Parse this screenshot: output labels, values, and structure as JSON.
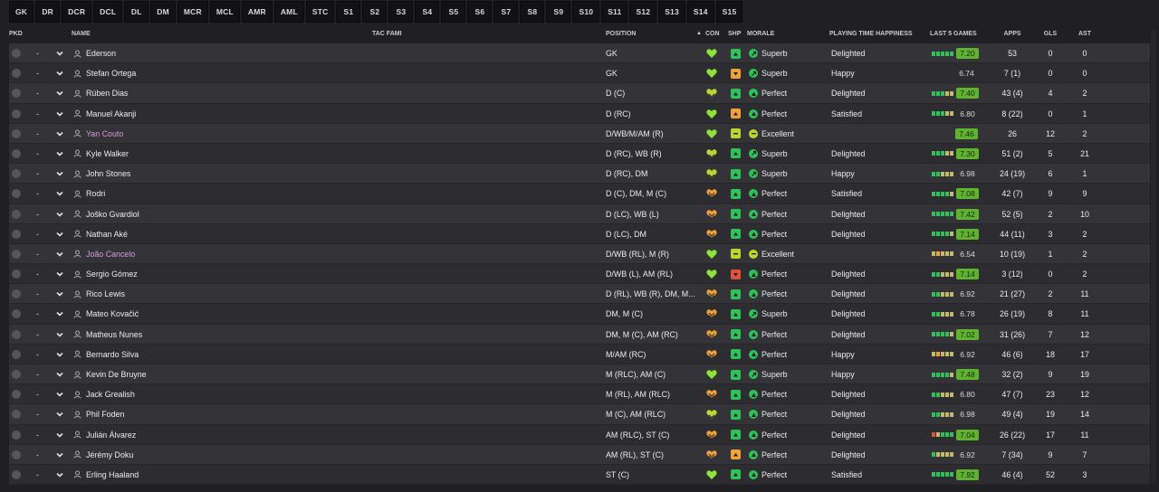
{
  "positions": [
    "GK",
    "DR",
    "DCR",
    "DCL",
    "DL",
    "DM",
    "MCR",
    "MCL",
    "AMR",
    "AML",
    "STC",
    "S1",
    "S2",
    "S3",
    "S4",
    "S5",
    "S6",
    "S7",
    "S8",
    "S9",
    "S10",
    "S11",
    "S12",
    "S13",
    "S14",
    "S15"
  ],
  "columns": {
    "pkd": "PKD",
    "name": "NAME",
    "tac_fami": "TAC FAMI",
    "position": "POSITION",
    "con": "CON",
    "shp": "SHP",
    "morale": "MORALE",
    "happiness": "PLAYING TIME HAPPINESS",
    "last5": "LAST 5 GAMES",
    "apps": "APPS",
    "gls": "GLS",
    "ast": "AST"
  },
  "colors": {
    "green": "#2fc15a",
    "light_green": "#8fe23a",
    "yellow_green": "#b9d631",
    "orange": "#f0a23a",
    "red": "#e0523a",
    "rating_green": "#5fb42e"
  },
  "players": [
    {
      "dash": "-",
      "name": "Ederson",
      "highlight": false,
      "position": "GK",
      "con": "green",
      "shp": "up-green",
      "morale": "Superb",
      "morale_icon": "superb",
      "happiness": "Delighted",
      "form": [
        "g",
        "g",
        "g",
        "g",
        "g"
      ],
      "rating": "7.20",
      "rating_good": true,
      "apps": "53",
      "gls": "0",
      "ast": "0"
    },
    {
      "dash": "-",
      "name": "Stefan Ortega",
      "highlight": false,
      "position": "GK",
      "con": "green",
      "shp": "down-orange",
      "morale": "Superb",
      "morale_icon": "superb",
      "happiness": "Happy",
      "form": [],
      "rating": "6.74",
      "rating_good": false,
      "apps": "7 (1)",
      "gls": "0",
      "ast": "0"
    },
    {
      "dash": "-",
      "name": "Rúben Dias",
      "highlight": false,
      "position": "D (C)",
      "con": "yellow",
      "shp": "up-green",
      "morale": "Perfect",
      "morale_icon": "perfect",
      "happiness": "Delighted",
      "form": [
        "g",
        "g",
        "g",
        "y",
        "y"
      ],
      "rating": "7.40",
      "rating_good": true,
      "apps": "43 (4)",
      "gls": "4",
      "ast": "2"
    },
    {
      "dash": "-",
      "name": "Manuel Akanji",
      "highlight": false,
      "position": "D (RC)",
      "con": "green",
      "shp": "up-orange",
      "morale": "Perfect",
      "morale_icon": "perfect",
      "happiness": "Satisfied",
      "form": [
        "g",
        "g",
        "g",
        "y",
        "y"
      ],
      "rating": "6.80",
      "rating_good": false,
      "apps": "8 (22)",
      "gls": "0",
      "ast": "1"
    },
    {
      "dash": "-",
      "name": "Yan Couto",
      "highlight": true,
      "position": "D/WB/M/AM (R)",
      "con": "green",
      "shp": "neutral-yellow",
      "morale": "Excellent",
      "morale_icon": "excellent",
      "happiness": "",
      "form": [],
      "rating": "7.46",
      "rating_good": true,
      "apps": "26",
      "gls": "12",
      "ast": "2"
    },
    {
      "dash": "-",
      "name": "Kyle Walker",
      "highlight": false,
      "position": "D (RC), WB (R)",
      "con": "yellow",
      "shp": "up-green",
      "morale": "Superb",
      "morale_icon": "superb",
      "happiness": "Delighted",
      "form": [
        "g",
        "g",
        "g",
        "y",
        "y"
      ],
      "rating": "7.30",
      "rating_good": true,
      "apps": "51 (2)",
      "gls": "5",
      "ast": "21"
    },
    {
      "dash": "-",
      "name": "John Stones",
      "highlight": false,
      "position": "D (RC), DM",
      "con": "yellow",
      "shp": "up-green",
      "morale": "Superb",
      "morale_icon": "superb",
      "happiness": "Happy",
      "form": [
        "g",
        "g",
        "y",
        "y",
        "y"
      ],
      "rating": "6.98",
      "rating_good": false,
      "apps": "24 (19)",
      "gls": "6",
      "ast": "1"
    },
    {
      "dash": "-",
      "name": "Rodri",
      "highlight": false,
      "position": "D (C), DM, M (C)",
      "con": "orange",
      "shp": "up-green",
      "morale": "Perfect",
      "morale_icon": "perfect",
      "happiness": "Satisfied",
      "form": [
        "g",
        "g",
        "g",
        "g",
        "y"
      ],
      "rating": "7.08",
      "rating_good": true,
      "apps": "42 (7)",
      "gls": "9",
      "ast": "9"
    },
    {
      "dash": "-",
      "name": "Joško Gvardiol",
      "highlight": false,
      "position": "D (LC), WB (L)",
      "con": "orange",
      "shp": "up-green",
      "morale": "Perfect",
      "morale_icon": "perfect",
      "happiness": "Delighted",
      "form": [
        "g",
        "g",
        "g",
        "g",
        "g"
      ],
      "rating": "7.42",
      "rating_good": true,
      "apps": "52 (5)",
      "gls": "2",
      "ast": "10"
    },
    {
      "dash": "-",
      "name": "Nathan Aké",
      "highlight": false,
      "position": "D (LC), DM",
      "con": "orange",
      "shp": "up-green",
      "morale": "Perfect",
      "morale_icon": "perfect",
      "happiness": "Delighted",
      "form": [
        "g",
        "g",
        "g",
        "g",
        "y"
      ],
      "rating": "7.14",
      "rating_good": true,
      "apps": "44 (11)",
      "gls": "3",
      "ast": "2"
    },
    {
      "dash": "-",
      "name": "João Cancelo",
      "highlight": true,
      "position": "D/WB (RL), M (R)",
      "con": "green",
      "shp": "neutral-yellow",
      "morale": "Excellent",
      "morale_icon": "excellent",
      "happiness": "",
      "form": [
        "y",
        "o",
        "y",
        "y",
        "y"
      ],
      "rating": "6.54",
      "rating_good": false,
      "apps": "10 (19)",
      "gls": "1",
      "ast": "2"
    },
    {
      "dash": "-",
      "name": "Sergio Gómez",
      "highlight": false,
      "position": "D/WB (L), AM (RL)",
      "con": "green",
      "shp": "down-red",
      "morale": "Perfect",
      "morale_icon": "perfect",
      "happiness": "Delighted",
      "form": [
        "g",
        "g",
        "y",
        "y",
        "y"
      ],
      "rating": "7.14",
      "rating_good": true,
      "apps": "3 (12)",
      "gls": "0",
      "ast": "2"
    },
    {
      "dash": "-",
      "name": "Rico Lewis",
      "highlight": false,
      "position": "D (RL), WB (R), DM, M...",
      "con": "orange",
      "shp": "up-green",
      "morale": "Perfect",
      "morale_icon": "perfect",
      "happiness": "Delighted",
      "form": [
        "g",
        "g",
        "y",
        "y",
        "y"
      ],
      "rating": "6.92",
      "rating_good": false,
      "apps": "21 (27)",
      "gls": "2",
      "ast": "11"
    },
    {
      "dash": "-",
      "name": "Mateo Kovačić",
      "highlight": false,
      "position": "DM, M (C)",
      "con": "orange",
      "shp": "up-green",
      "morale": "Superb",
      "morale_icon": "superb",
      "happiness": "Delighted",
      "form": [
        "g",
        "g",
        "y",
        "y",
        "y"
      ],
      "rating": "6.78",
      "rating_good": false,
      "apps": "26 (19)",
      "gls": "8",
      "ast": "11"
    },
    {
      "dash": "-",
      "name": "Matheus Nunes",
      "highlight": false,
      "position": "DM, M (C), AM (RC)",
      "con": "orange",
      "shp": "up-green",
      "morale": "Perfect",
      "morale_icon": "perfect",
      "happiness": "Delighted",
      "form": [
        "g",
        "g",
        "g",
        "g",
        "y"
      ],
      "rating": "7.02",
      "rating_good": true,
      "apps": "31 (26)",
      "gls": "7",
      "ast": "12"
    },
    {
      "dash": "-",
      "name": "Bernardo Silva",
      "highlight": false,
      "position": "M/AM (RC)",
      "con": "orange",
      "shp": "up-green",
      "morale": "Perfect",
      "morale_icon": "perfect",
      "happiness": "Happy",
      "form": [
        "y",
        "o",
        "y",
        "y",
        "y"
      ],
      "rating": "6.92",
      "rating_good": false,
      "apps": "46 (6)",
      "gls": "18",
      "ast": "17"
    },
    {
      "dash": "-",
      "name": "Kevin De Bruyne",
      "highlight": false,
      "position": "M (RLC), AM (C)",
      "con": "green",
      "shp": "up-green",
      "morale": "Superb",
      "morale_icon": "superb",
      "happiness": "Happy",
      "form": [
        "g",
        "g",
        "g",
        "g",
        "y"
      ],
      "rating": "7.48",
      "rating_good": true,
      "apps": "32 (2)",
      "gls": "9",
      "ast": "19"
    },
    {
      "dash": "-",
      "name": "Jack Grealish",
      "highlight": false,
      "position": "M (RL), AM (RLC)",
      "con": "orange",
      "shp": "up-green",
      "morale": "Perfect",
      "morale_icon": "perfect",
      "happiness": "Delighted",
      "form": [
        "g",
        "g",
        "y",
        "y",
        "y"
      ],
      "rating": "6.80",
      "rating_good": false,
      "apps": "47 (7)",
      "gls": "23",
      "ast": "12"
    },
    {
      "dash": "-",
      "name": "Phil Foden",
      "highlight": false,
      "position": "M (C), AM (RLC)",
      "con": "yellow",
      "shp": "up-green",
      "morale": "Perfect",
      "morale_icon": "perfect",
      "happiness": "Delighted",
      "form": [
        "g",
        "g",
        "y",
        "y",
        "y"
      ],
      "rating": "6.98",
      "rating_good": false,
      "apps": "49 (4)",
      "gls": "19",
      "ast": "14"
    },
    {
      "dash": "-",
      "name": "Julián Álvarez",
      "highlight": false,
      "position": "AM (RLC), ST (C)",
      "con": "orange",
      "shp": "up-green",
      "morale": "Perfect",
      "morale_icon": "perfect",
      "happiness": "Delighted",
      "form": [
        "r",
        "y",
        "g",
        "g",
        "g"
      ],
      "rating": "7.04",
      "rating_good": true,
      "apps": "26 (22)",
      "gls": "17",
      "ast": "11"
    },
    {
      "dash": "-",
      "name": "Jérémy Doku",
      "highlight": false,
      "position": "AM (RL), ST (C)",
      "con": "orange",
      "shp": "up-orange",
      "morale": "Perfect",
      "morale_icon": "perfect",
      "happiness": "Delighted",
      "form": [
        "g",
        "y",
        "y",
        "y",
        "y"
      ],
      "rating": "6.92",
      "rating_good": false,
      "apps": "7 (34)",
      "gls": "9",
      "ast": "7"
    },
    {
      "dash": "-",
      "name": "Erling Haaland",
      "highlight": false,
      "position": "ST (C)",
      "con": "green",
      "shp": "up-green",
      "morale": "Perfect",
      "morale_icon": "perfect",
      "happiness": "Satisfied",
      "form": [
        "g",
        "g",
        "g",
        "g",
        "g"
      ],
      "rating": "7.92",
      "rating_good": true,
      "apps": "46 (4)",
      "gls": "52",
      "ast": "3"
    }
  ]
}
